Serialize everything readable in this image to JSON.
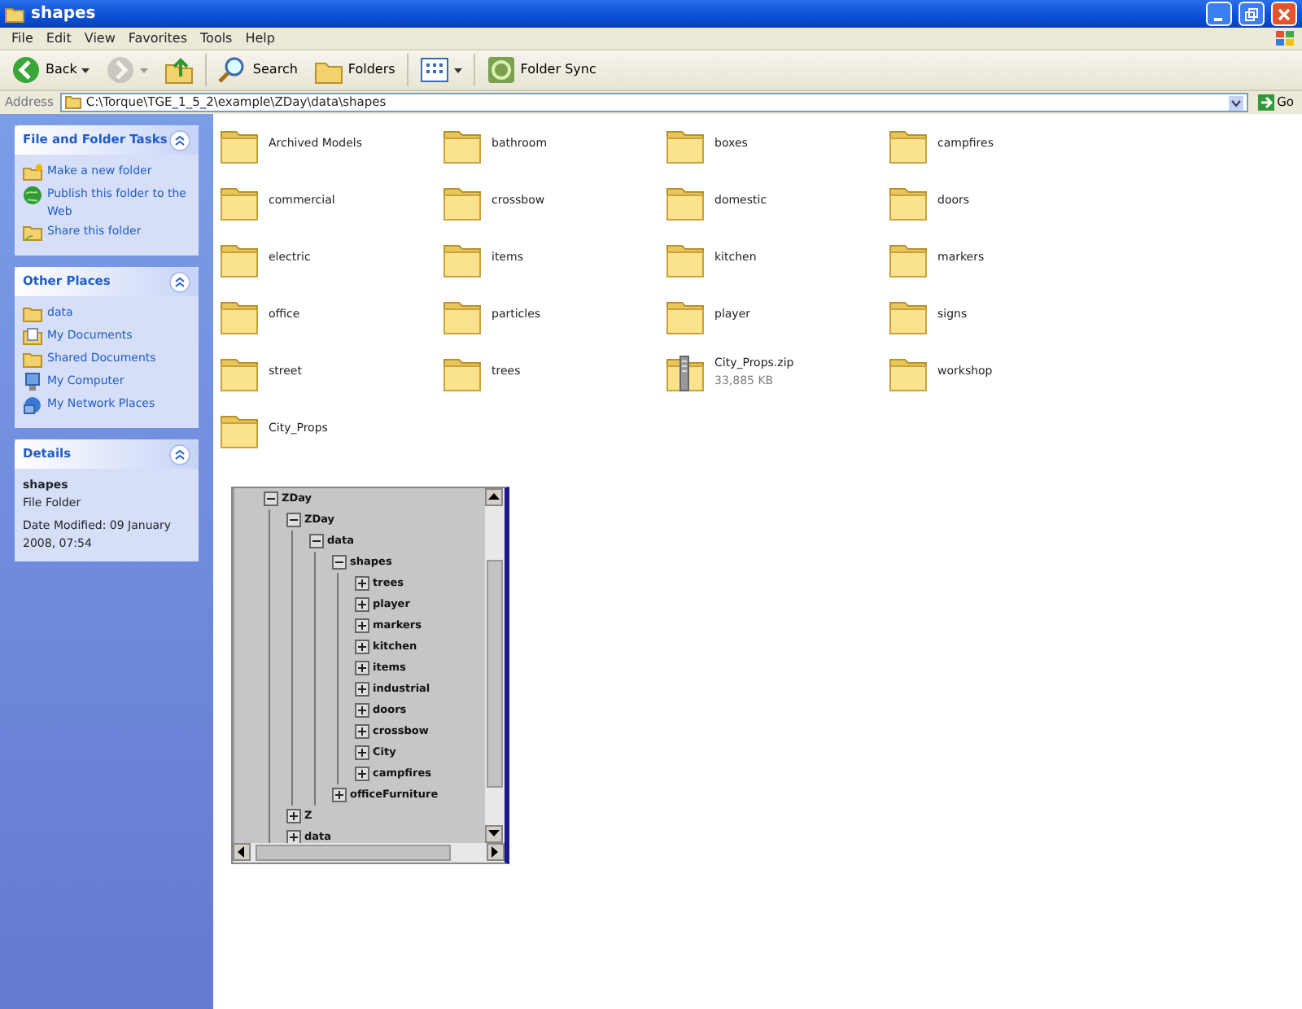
{
  "window": {
    "title": "shapes"
  },
  "menu": [
    "File",
    "Edit",
    "View",
    "Favorites",
    "Tools",
    "Help"
  ],
  "toolbar": [
    {
      "kind": "back",
      "label": "Back",
      "disabled": false
    },
    {
      "kind": "forward",
      "disabled": true
    },
    {
      "kind": "up",
      "disabled": false
    },
    {
      "kind": "search",
      "label": "Search",
      "disabled": false
    },
    {
      "kind": "folders",
      "label": "Folders",
      "disabled": false
    },
    {
      "kind": "views",
      "disabled": false
    },
    {
      "kind": "sync",
      "label": "Folder Sync",
      "disabled": false
    }
  ],
  "address": {
    "label": "Address",
    "value": "C:\\Torque\\TGE_1_5_2\\example\\ZDay\\data\\shapes",
    "go": "Go"
  },
  "sidebar": [
    {
      "kind": "links",
      "title": "File and Folder Tasks",
      "expanded": true,
      "items": [
        {
          "kind": "newfolder",
          "label": "Make a new folder"
        },
        {
          "kind": "globe",
          "label": "Publish this folder to the Web"
        },
        {
          "kind": "share",
          "label": "Share this folder"
        }
      ]
    },
    {
      "kind": "links",
      "title": "Other Places",
      "expanded": true,
      "items": [
        {
          "kind": "folder",
          "label": "data"
        },
        {
          "kind": "docs",
          "label": "My Documents"
        },
        {
          "kind": "folder",
          "label": "Shared Documents"
        },
        {
          "kind": "computer",
          "label": "My Computer"
        },
        {
          "kind": "network",
          "label": "My Network Places"
        }
      ]
    },
    {
      "kind": "details",
      "title": "Details",
      "expanded": true,
      "name": "shapes",
      "type": "File Folder",
      "modified": "Date Modified: 09 January 2008, 07:54"
    }
  ],
  "files": [
    {
      "kind": "folder",
      "name": "Archived Models"
    },
    {
      "kind": "folder",
      "name": "bathroom"
    },
    {
      "kind": "folder",
      "name": "boxes"
    },
    {
      "kind": "folder",
      "name": "campfires"
    },
    {
      "kind": "folder",
      "name": "commercial"
    },
    {
      "kind": "folder",
      "name": "crossbow"
    },
    {
      "kind": "folder",
      "name": "domestic"
    },
    {
      "kind": "folder",
      "name": "doors"
    },
    {
      "kind": "folder",
      "name": "electric"
    },
    {
      "kind": "folder",
      "name": "items"
    },
    {
      "kind": "folder",
      "name": "kitchen"
    },
    {
      "kind": "folder",
      "name": "markers"
    },
    {
      "kind": "folder",
      "name": "office"
    },
    {
      "kind": "folder",
      "name": "particles"
    },
    {
      "kind": "folder",
      "name": "player"
    },
    {
      "kind": "folder",
      "name": "signs"
    },
    {
      "kind": "folder",
      "name": "street"
    },
    {
      "kind": "folder",
      "name": "trees"
    },
    {
      "kind": "zip",
      "name": "City_Props.zip",
      "size": "33,885 KB"
    },
    {
      "kind": "folder",
      "name": "workshop"
    },
    {
      "kind": "folder",
      "name": "City_Props"
    }
  ],
  "tree": [
    {
      "label": "ZDay",
      "expanded": true,
      "children": [
        {
          "label": "ZDay",
          "expanded": true,
          "children": [
            {
              "label": "data",
              "expanded": true,
              "children": [
                {
                  "label": "shapes",
                  "expanded": true,
                  "children": [
                    {
                      "label": "trees",
                      "expanded": false
                    },
                    {
                      "label": "player",
                      "expanded": false
                    },
                    {
                      "label": "markers",
                      "expanded": false
                    },
                    {
                      "label": "kitchen",
                      "expanded": false
                    },
                    {
                      "label": "items",
                      "expanded": false
                    },
                    {
                      "label": "industrial",
                      "expanded": false
                    },
                    {
                      "label": "doors",
                      "expanded": false
                    },
                    {
                      "label": "crossbow",
                      "expanded": false
                    },
                    {
                      "label": "City",
                      "expanded": false
                    },
                    {
                      "label": "campfires",
                      "expanded": false
                    }
                  ]
                },
                {
                  "label": "officeFurniture",
                  "expanded": false
                }
              ]
            }
          ]
        },
        {
          "label": "Z",
          "expanded": false
        },
        {
          "label": "data",
          "expanded": false
        }
      ]
    }
  ]
}
